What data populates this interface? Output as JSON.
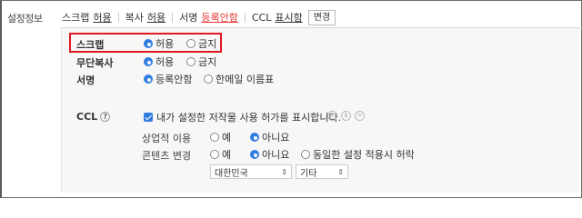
{
  "settings_label": "설정정보",
  "summary": {
    "scrap_key": "스크랩",
    "scrap_val": "허용",
    "copy_key": "복사",
    "copy_val": "허용",
    "sign_key": "서명",
    "sign_val": "등록안함",
    "ccl_key": "CCL",
    "ccl_val": "표시함",
    "edit_label": "변경"
  },
  "rows": {
    "scrap": {
      "label": "스크랩",
      "opt1": "허용",
      "opt2": "금지",
      "selected": "허용"
    },
    "copy": {
      "label": "무단복사",
      "opt1": "허용",
      "opt2": "금지",
      "selected": "허용"
    },
    "sign": {
      "label": "서명",
      "opt1": "등록안함",
      "opt2": "한메일 이름표",
      "selected": "등록안함"
    }
  },
  "ccl": {
    "label": "CCL",
    "help_icon": "question-icon",
    "checkbox_text": "내가 설정한 저작물 사용 허가를 표시합니다.",
    "checked": true,
    "commercial": {
      "label": "상업적 이용",
      "opt1": "예",
      "opt2": "아니요",
      "selected": "아니요"
    },
    "modify": {
      "label": "콘텐츠 변경",
      "opt1": "예",
      "opt2": "아니요",
      "opt3": "동일한 설정 적용시 허락",
      "selected": "아니요"
    },
    "country": "대한민국",
    "other": "기타"
  },
  "colors": {
    "accent": "#2f7de1",
    "highlight": "#e0191f",
    "link_red": "#e53935"
  }
}
